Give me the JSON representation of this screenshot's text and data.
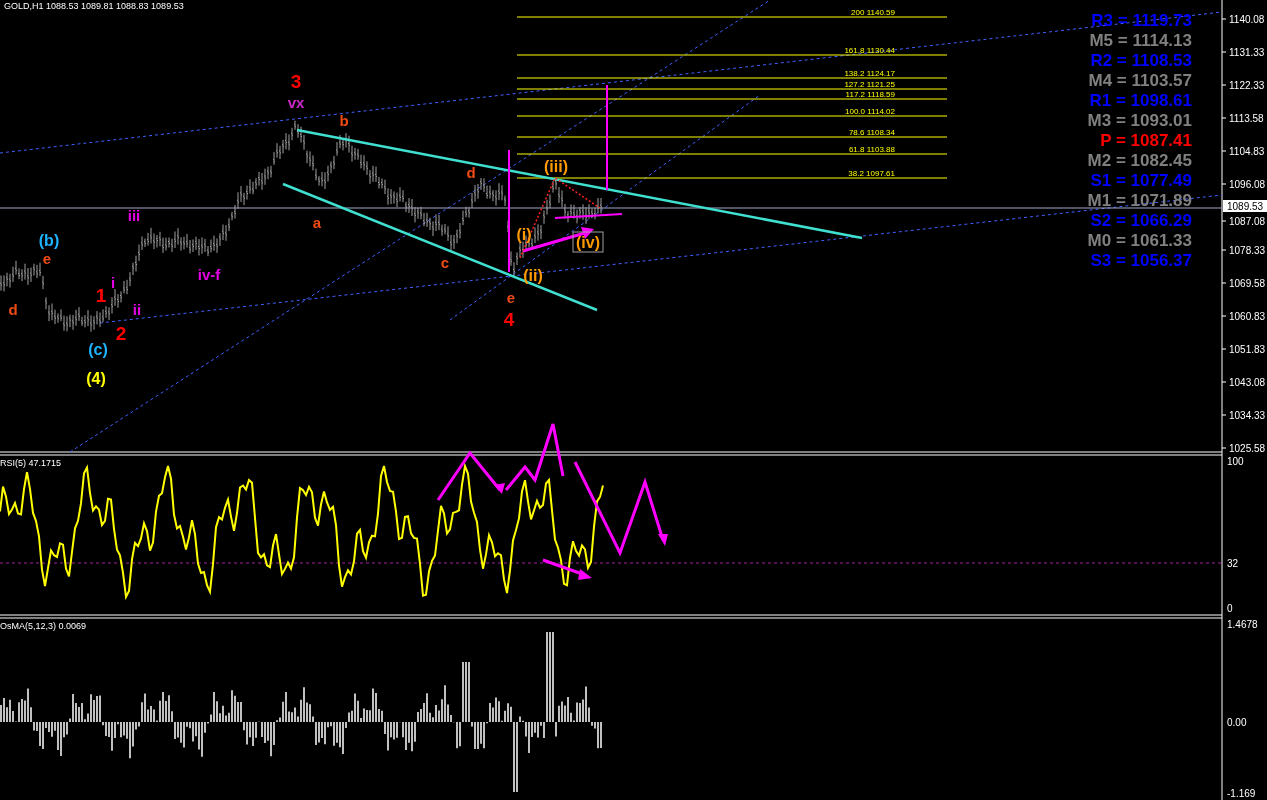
{
  "header": {
    "symbol_line": "GOLD,H1 1088.53 1089.81 1088.83 1089.53"
  },
  "main_chart": {
    "wave_labels": [
      {
        "text": "3",
        "color": "#ff0000",
        "kind": "major"
      },
      {
        "text": "vx",
        "color": "#c828c8",
        "kind": "minor"
      },
      {
        "text": "b",
        "color": "#f04b14",
        "kind": "minor"
      },
      {
        "text": "a",
        "color": "#f04b14",
        "kind": "minor"
      },
      {
        "text": "d",
        "color": "#f04b14",
        "kind": "minor"
      },
      {
        "text": "c",
        "color": "#f04b14",
        "kind": "minor"
      },
      {
        "text": "e",
        "color": "#f04b14",
        "kind": "minor"
      },
      {
        "text": "4",
        "color": "#ff0000",
        "kind": "major"
      },
      {
        "text": "(iii)",
        "color": "#ff9a00",
        "kind": "mid"
      },
      {
        "text": "(i)",
        "color": "#ff9a00",
        "kind": "mid"
      },
      {
        "text": "(ii)",
        "color": "#ff9a00",
        "kind": "mid"
      },
      {
        "text": "(iv)",
        "color": "#ff9a00",
        "kind": "boxed"
      },
      {
        "text": "(b)",
        "color": "#1eb4ff",
        "kind": "mid"
      },
      {
        "text": "e",
        "color": "#f04b14",
        "kind": "minor"
      },
      {
        "text": "d",
        "color": "#f04b14",
        "kind": "minor"
      },
      {
        "text": "iii",
        "color": "#e600e6",
        "kind": "minor"
      },
      {
        "text": "i",
        "color": "#e600e6",
        "kind": "minor"
      },
      {
        "text": "ii",
        "color": "#e600e6",
        "kind": "minor"
      },
      {
        "text": "iv-f",
        "color": "#e600e6",
        "kind": "minor"
      },
      {
        "text": "1",
        "color": "#ff0000",
        "kind": "major"
      },
      {
        "text": "2",
        "color": "#ff0000",
        "kind": "major"
      },
      {
        "text": "(c)",
        "color": "#1eb4ff",
        "kind": "mid"
      },
      {
        "text": "(4)",
        "color": "#ffff00",
        "kind": "mid"
      }
    ],
    "fib_levels": [
      {
        "label": "200 1140.59"
      },
      {
        "label": "161.8 1130.44"
      },
      {
        "label": "138.2 1124.17"
      },
      {
        "label": "127.2 1121.25"
      },
      {
        "label": "117.2 1118.59"
      },
      {
        "label": "100.0   1114.02"
      },
      {
        "label": "78.6 1108.34"
      },
      {
        "label": "61.8 1103.88"
      },
      {
        "label": "38.2 1097.61"
      }
    ],
    "pivots": [
      {
        "text": "R3 = 1119.73",
        "color": "#0000ff"
      },
      {
        "text": "M5 = 1114.13",
        "color": "#808080"
      },
      {
        "text": "R2 = 1108.53",
        "color": "#0000ff"
      },
      {
        "text": "M4 = 1103.57",
        "color": "#808080"
      },
      {
        "text": "R1 = 1098.61",
        "color": "#0000ff"
      },
      {
        "text": "M3 = 1093.01",
        "color": "#808080"
      },
      {
        "text": "P  = 1087.41",
        "color": "#ff0000"
      },
      {
        "text": "M2 = 1082.45",
        "color": "#808080"
      },
      {
        "text": "S1 = 1077.49",
        "color": "#0000ff"
      },
      {
        "text": "M1 = 1071.89",
        "color": "#808080"
      },
      {
        "text": "S2 = 1066.29",
        "color": "#0000ff"
      },
      {
        "text": "M0 = 1061.33",
        "color": "#808080"
      },
      {
        "text": "S3 = 1056.37",
        "color": "#0000ff"
      }
    ],
    "price_axis": [
      "1140.08",
      "1131.33",
      "1122.33",
      "1113.58",
      "1104.83",
      "1096.08",
      "1087.08",
      "1078.33",
      "1069.58",
      "1060.83",
      "1051.83",
      "1043.08",
      "1034.33",
      "1025.58"
    ],
    "current_price": "1089.53"
  },
  "rsi": {
    "title": "RSI(5) 47.1715",
    "axis": [
      "100",
      "32",
      "0"
    ]
  },
  "osma": {
    "title": "OsMA(5,12,3) 0.0069",
    "axis": [
      "1.4678",
      "0.00",
      "-1.169"
    ]
  }
}
